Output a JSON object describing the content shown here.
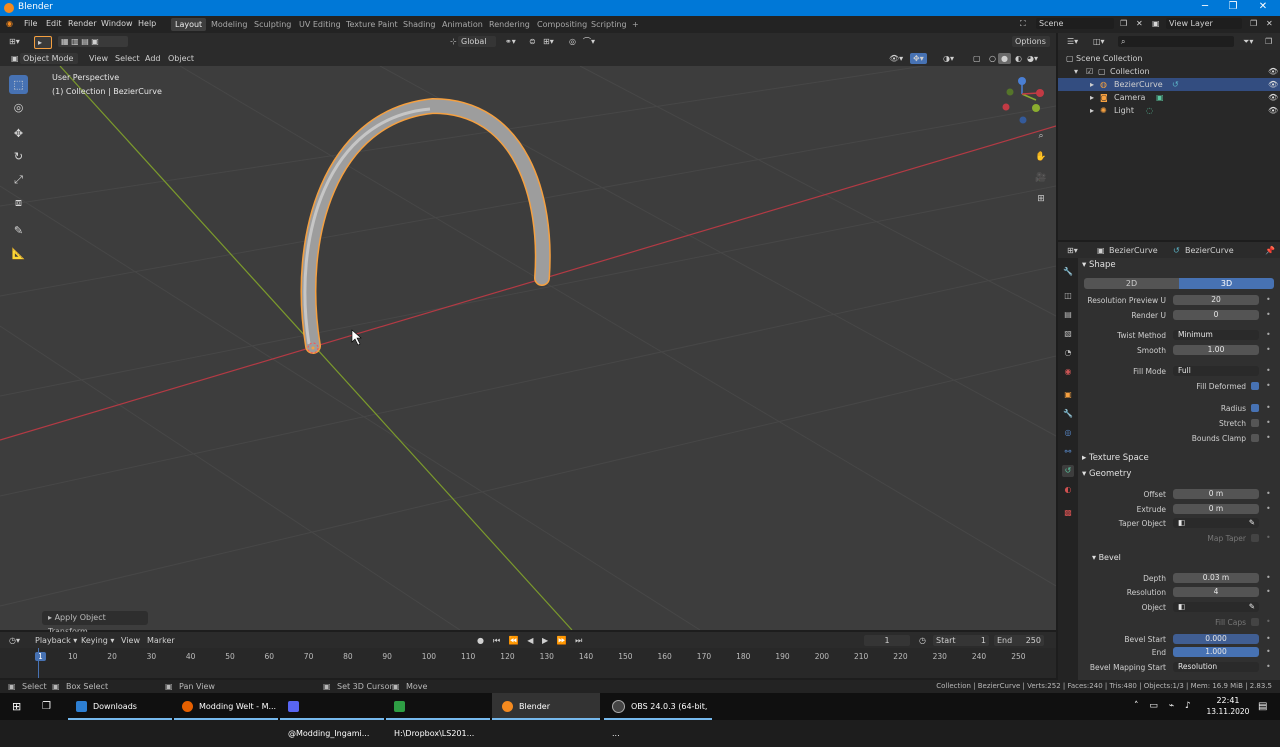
{
  "window": {
    "title": "Blender"
  },
  "menu": [
    "File",
    "Edit",
    "Render",
    "Window",
    "Help"
  ],
  "workspaces": [
    "Layout",
    "Modeling",
    "Sculpting",
    "UV Editing",
    "Texture Paint",
    "Shading",
    "Animation",
    "Rendering",
    "Compositing",
    "Scripting"
  ],
  "scene": "Scene",
  "view_layer": "View Layer",
  "tool_header": {
    "transform": "Global",
    "options": "Options"
  },
  "viewport_header": {
    "mode": "Object Mode",
    "items": [
      "View",
      "Select",
      "Add",
      "Object"
    ]
  },
  "viewport": {
    "perspective": "User Perspective",
    "collection_info": "(1) Collection | BezierCurve",
    "last_operator": "Apply Object Transform"
  },
  "outliner": {
    "items": [
      {
        "label": "Scene Collection",
        "level": 0,
        "selected": false
      },
      {
        "label": "Collection",
        "level": 1,
        "selected": false
      },
      {
        "label": "BezierCurve",
        "level": 2,
        "selected": true
      },
      {
        "label": "Camera",
        "level": 2,
        "selected": false
      },
      {
        "label": "Light",
        "level": 2,
        "selected": false
      }
    ]
  },
  "properties": {
    "object_name": "BezierCurve",
    "data_name": "BezierCurve",
    "shape": {
      "title": "Shape",
      "dim_2d": "2D",
      "dim_3d": "3D",
      "resolution_preview_label": "Resolution Preview U",
      "resolution_preview": "20",
      "render_u_label": "Render U",
      "render_u": "0",
      "twist_method_label": "Twist Method",
      "twist_method": "Minimum",
      "smooth_label": "Smooth",
      "smooth": "1.00",
      "fill_mode_label": "Fill Mode",
      "fill_mode": "Full",
      "fill_deformed_label": "Fill Deformed",
      "radius_label": "Radius",
      "stretch_label": "Stretch",
      "bounds_clamp_label": "Bounds Clamp"
    },
    "texture_space": {
      "title": "Texture Space"
    },
    "geometry": {
      "title": "Geometry",
      "offset_label": "Offset",
      "offset": "0 m",
      "extrude_label": "Extrude",
      "extrude": "0 m",
      "taper_label": "Taper Object",
      "map_taper_label": "Map Taper"
    },
    "bevel": {
      "title": "Bevel",
      "depth_label": "Depth",
      "depth": "0.03 m",
      "resolution_label": "Resolution",
      "resolution": "4",
      "object_label": "Object",
      "fill_caps_label": "Fill Caps",
      "bevel_start_label": "Bevel Start",
      "bevel_start": "0.000",
      "end_label": "End",
      "end": "1.000",
      "mapping_start_label": "Bevel Mapping Start",
      "mapping_start": "Resolution"
    }
  },
  "timeline": {
    "menus": [
      "Playback",
      "Keying",
      "View",
      "Marker"
    ],
    "current_frame": "1",
    "start_label": "Start",
    "start": "1",
    "end_label": "End",
    "end": "250",
    "ticks": [
      "1",
      "10",
      "20",
      "30",
      "40",
      "50",
      "60",
      "70",
      "80",
      "90",
      "100",
      "110",
      "120",
      "130",
      "140",
      "150",
      "160",
      "170",
      "180",
      "190",
      "200",
      "210",
      "220",
      "230",
      "240",
      "250"
    ]
  },
  "statusbar": {
    "select": "Select",
    "box_select": "Box Select",
    "pan_view": "Pan View",
    "set_cursor": "Set 3D Cursor",
    "move": "Move",
    "stats": "Collection | BezierCurve | Verts:252 | Faces:240 | Tris:480 | Objects:1/3 | Mem: 16.9 MiB | 2.83.5"
  },
  "taskbar": {
    "apps": [
      {
        "label": "Downloads",
        "color": "#2d7fd3"
      },
      {
        "label": "Modding Welt - M...",
        "color": "#e66000"
      },
      {
        "label": "@Modding_Ingami...",
        "color": "#5865f2"
      },
      {
        "label": "H:\\Dropbox\\LS201...",
        "color": "#2e9e44"
      },
      {
        "label": "Blender",
        "color": "#f58a1f"
      },
      {
        "label": "OBS 24.0.3 (64-bit, ...",
        "color": "#444444"
      }
    ],
    "time": "22:41",
    "date": "13.11.2020"
  },
  "colors": {
    "accent": "#4772b3",
    "selection_outline": "#f5a040",
    "x_axis": "#c23a44",
    "y_axis": "#8bad2f"
  }
}
